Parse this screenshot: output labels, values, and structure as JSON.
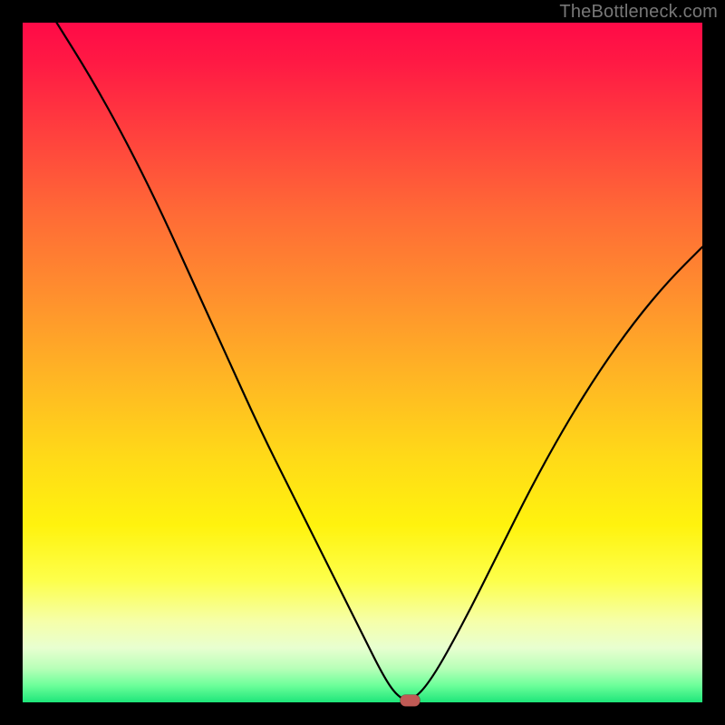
{
  "watermark": "TheBottleneck.com",
  "chart_data": {
    "type": "line",
    "title": "",
    "xlabel": "",
    "ylabel": "",
    "xlim": [
      0,
      100
    ],
    "ylim": [
      0,
      100
    ],
    "grid": false,
    "legend": false,
    "series": [
      {
        "name": "bottleneck-curve",
        "x": [
          5,
          10,
          15,
          20,
          25,
          30,
          35,
          40,
          45,
          50,
          53,
          55,
          57,
          60,
          65,
          70,
          75,
          80,
          85,
          90,
          95,
          100
        ],
        "values": [
          100,
          92,
          83,
          73,
          62,
          51,
          40,
          30,
          20,
          10,
          4,
          1,
          0,
          3,
          12,
          22,
          32,
          41,
          49,
          56,
          62,
          67
        ]
      }
    ],
    "marker": {
      "x": 57,
      "y": 0,
      "shape": "pill",
      "color": "#c05a55"
    },
    "background_gradient": {
      "stops": [
        {
          "pos": 0.0,
          "color": "#ff0a47"
        },
        {
          "pos": 0.4,
          "color": "#ff8f2e"
        },
        {
          "pos": 0.7,
          "color": "#fff000"
        },
        {
          "pos": 0.92,
          "color": "#e8ffd0"
        },
        {
          "pos": 1.0,
          "color": "#1ee67a"
        }
      ]
    }
  }
}
